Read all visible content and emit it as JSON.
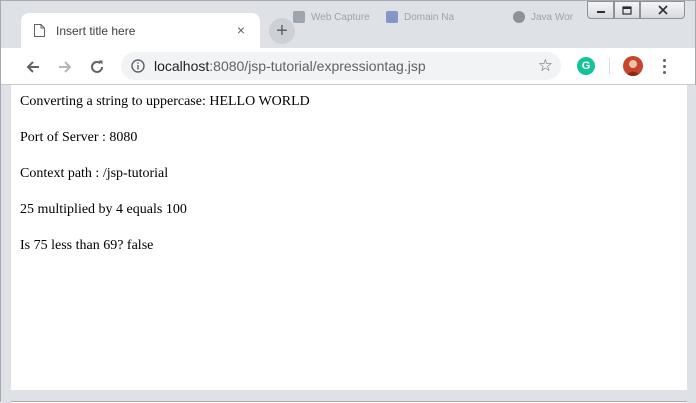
{
  "window": {
    "controls": [
      "minimize",
      "maximize",
      "close"
    ]
  },
  "tabs": {
    "active": {
      "title": "Insert title here",
      "close_label": "×"
    },
    "background": [
      {
        "title": "Web Capture"
      },
      {
        "title": "Domain Na"
      },
      {
        "title": "Java Wor"
      }
    ],
    "new_tab_label": "+"
  },
  "toolbar": {
    "url_host": "localhost",
    "url_rest": ":8080/jsp-tutorial/expressiontag.jsp",
    "grammarly_label": "G"
  },
  "page": {
    "lines": [
      "Converting a string to uppercase: HELLO WORLD",
      "Port of Server : 8080",
      "Context path : /jsp-tutorial",
      "25 multiplied by 4 equals 100",
      "Is 75 less than 69? false"
    ]
  },
  "colors": {
    "frame": "#dee1e6",
    "omnibox": "#f1f3f4",
    "grammarly": "#15c39a",
    "avatar": "#c7452d"
  },
  "icons": {
    "tab_favicon": "document-icon",
    "back": "arrow-left-icon",
    "forward": "arrow-right-icon",
    "reload": "reload-icon",
    "info": "info-icon",
    "bookmark": "star-icon",
    "extension": "grammarly-icon",
    "profile": "avatar",
    "menu": "more-vert-icon"
  }
}
